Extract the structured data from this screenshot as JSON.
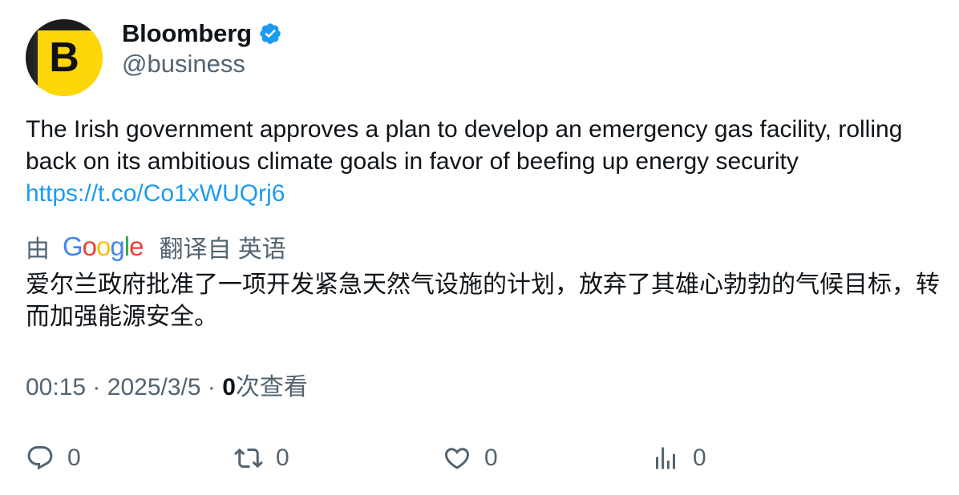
{
  "author": {
    "avatar_letter": "B",
    "display_name": "Bloomberg",
    "handle": "@business",
    "verified": true
  },
  "tweet": {
    "text": "The Irish government approves a plan to develop an emergency gas facility, rolling back on its ambitious climate goals in favor of beefing up energy security",
    "link": "https://t.co/Co1xWUQrj6"
  },
  "translation": {
    "by_label": "由",
    "provider_logo_letters": [
      "G",
      "o",
      "o",
      "g",
      "l",
      "e"
    ],
    "from_label": "翻译自 英语",
    "text": "爱尔兰政府批准了一项开发紧急天然气设施的计划，放弃了其雄心勃勃的气候目标，转而加强能源安全。"
  },
  "meta": {
    "time": "00:15",
    "separator": "·",
    "date": "2025/3/5",
    "views_count": "0",
    "views_label": "次查看"
  },
  "actions": {
    "reply": {
      "icon": "reply-icon",
      "count": "0"
    },
    "retweet": {
      "icon": "retweet-icon",
      "count": "0"
    },
    "like": {
      "icon": "heart-icon",
      "count": "0"
    },
    "views": {
      "icon": "analytics-icon",
      "count": "0"
    }
  },
  "colors": {
    "link": "#1d9bf0",
    "secondary_text": "#536471",
    "primary_text": "#0f1419",
    "verified_badge": "#1d9bf0",
    "avatar_yellow": "#ffd60a",
    "google_blue": "#4285f4",
    "google_red": "#ea4335",
    "google_yellow": "#fbbc05",
    "google_green": "#34a853"
  }
}
